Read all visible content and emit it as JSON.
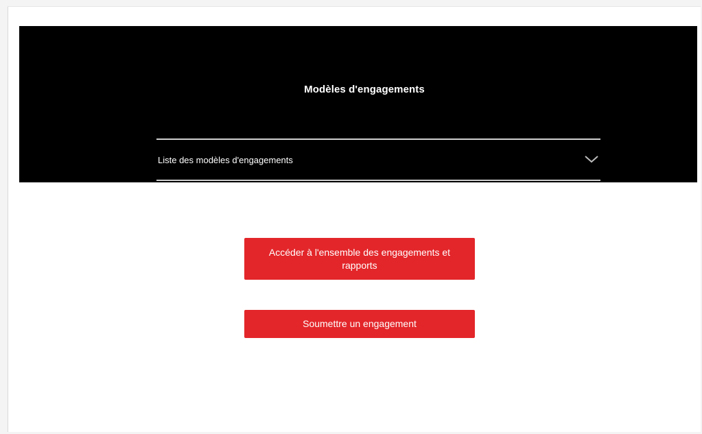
{
  "header": {
    "title": "Modèles d'engagements",
    "background_color": "#000000"
  },
  "dropdown": {
    "label": "Liste des modèles d'engagements",
    "icon": "chevron-down-icon"
  },
  "actions": {
    "access_all_label": "Accéder à l'ensemble des engagements et rapports",
    "submit_label": "Soumettre un engagement",
    "button_color": "#e3262a"
  }
}
